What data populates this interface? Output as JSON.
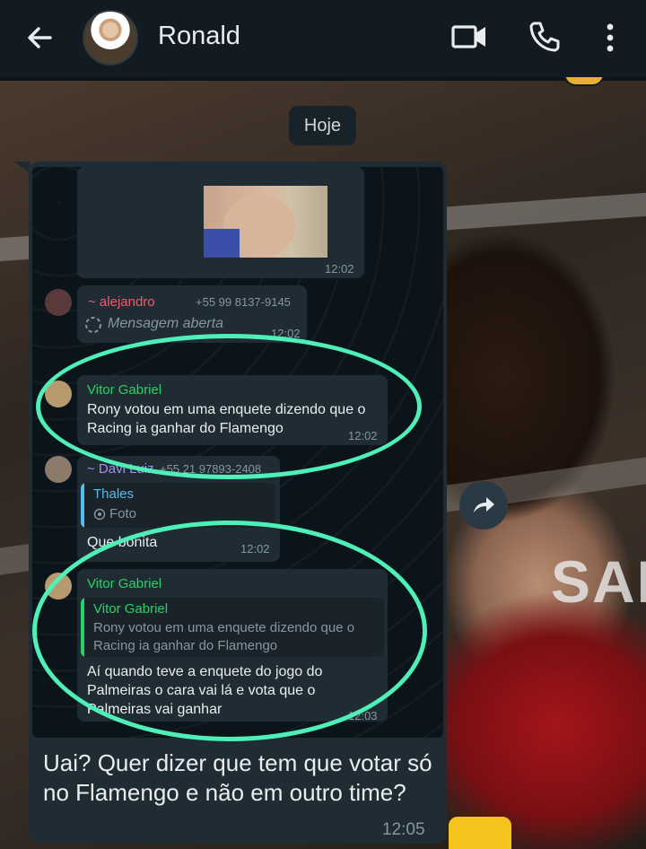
{
  "header": {
    "contact_name": "Ronald",
    "icons": [
      "back-arrow-icon",
      "video-call-icon",
      "phone-icon",
      "more-vert-icon"
    ]
  },
  "date_chip": "Hoje",
  "wallpaper_text": "SAI",
  "forwarded_screenshot": {
    "photo_message": {
      "time": "12:02"
    },
    "message_alejandro": {
      "sender": "~ alejandro",
      "phone": "+55 99 8137-9145",
      "text": "Mensagem aberta",
      "time": "12:02",
      "sender_color": "#f15c6d"
    },
    "message_vitor_1": {
      "sender": "Vitor Gabriel",
      "text": "Rony votou em uma enquete dizendo que o Racing ia ganhar do Flamengo",
      "time": "12:02",
      "sender_color": "#25d366"
    },
    "message_davi": {
      "sender": "~ Davi Luiz",
      "phone": "+55 21 97893-2408",
      "quote_name": "Thales",
      "quote_media": "Foto",
      "text": "Que bonita",
      "time": "12:02",
      "sender_color": "#a68cf5",
      "quote_color": "#53bdeb"
    },
    "message_vitor_2": {
      "sender": "Vitor Gabriel",
      "quote_name": "Vitor Gabriel",
      "quote_text": "Rony votou em uma enquete dizendo que o Racing ia ganhar do Flamengo",
      "text": "Aí quando teve a enquete do jogo do Palmeiras o cara vai lá e vota que o Palmeiras vai ganhar",
      "time": "12:03",
      "sender_color": "#25d366"
    }
  },
  "outer_message": {
    "text": "Uai? Quer dizer que tem que votar só no Flamengo e não em outro time?",
    "time": "12:05"
  },
  "colors": {
    "header_bg": "#111b21",
    "bubble_bg": "#1f2c34",
    "highlight": "#4ef0b8"
  }
}
